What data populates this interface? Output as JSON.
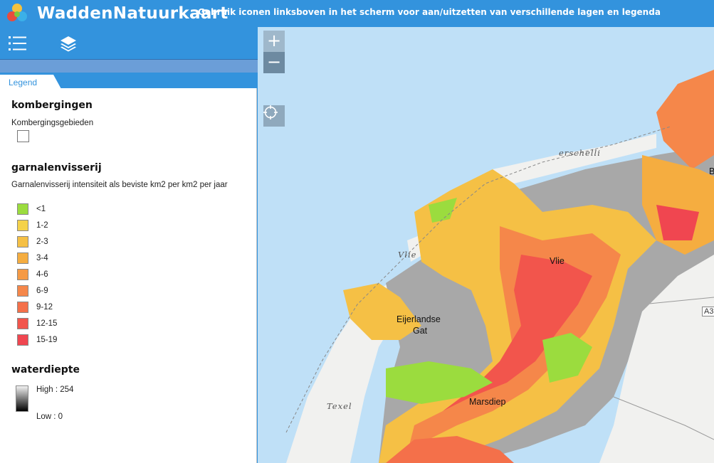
{
  "header": {
    "app_title": "WaddenNatuurkaart",
    "subtitle": "Gebruik iconen linksboven in het scherm voor aan/uitzetten van verschillende lagen en legenda"
  },
  "toolbar": {
    "legend_icon": "list-icon",
    "layers_icon": "layers-icon"
  },
  "panel": {
    "tab_label": "Legend",
    "sections": [
      {
        "title": "kombergingen",
        "layer_label": "Kombergingsgebieden"
      },
      {
        "title": "garnalenvisserij",
        "layer_label": "Garnalenvisserij intensiteit als beviste km2 per km2 per jaar",
        "items": [
          {
            "label": "<1",
            "color": "#9bdc3e"
          },
          {
            "label": "1-2",
            "color": "#f5d24a"
          },
          {
            "label": "2-3",
            "color": "#f5c045"
          },
          {
            "label": "3-4",
            "color": "#f5ad40"
          },
          {
            "label": "4-6",
            "color": "#f59a45"
          },
          {
            "label": "6-9",
            "color": "#f5874a"
          },
          {
            "label": "9-12",
            "color": "#f4704a"
          },
          {
            "label": "12-15",
            "color": "#f2554c"
          },
          {
            "label": "15-19",
            "color": "#f04650"
          }
        ]
      },
      {
        "title": "waterdiepte",
        "high_label": "High : 254",
        "low_label": "Low : 0"
      }
    ]
  },
  "map": {
    "zoom_in": "+",
    "zoom_out": "−",
    "labels": {
      "vlie": "Vlie",
      "eijerlandse_1": "Eijerlandse",
      "eijerlandse_2": "Gat",
      "marsdiep": "Marsdiep",
      "texel": "Texel",
      "vlieland": "Vlie",
      "terschelling": "erschelli",
      "road": "A3",
      "edge_b": "B"
    },
    "colors": {
      "sea": "#bfe0f7",
      "land": "#f1f1ef",
      "shallows": "#a8a8a8"
    }
  }
}
